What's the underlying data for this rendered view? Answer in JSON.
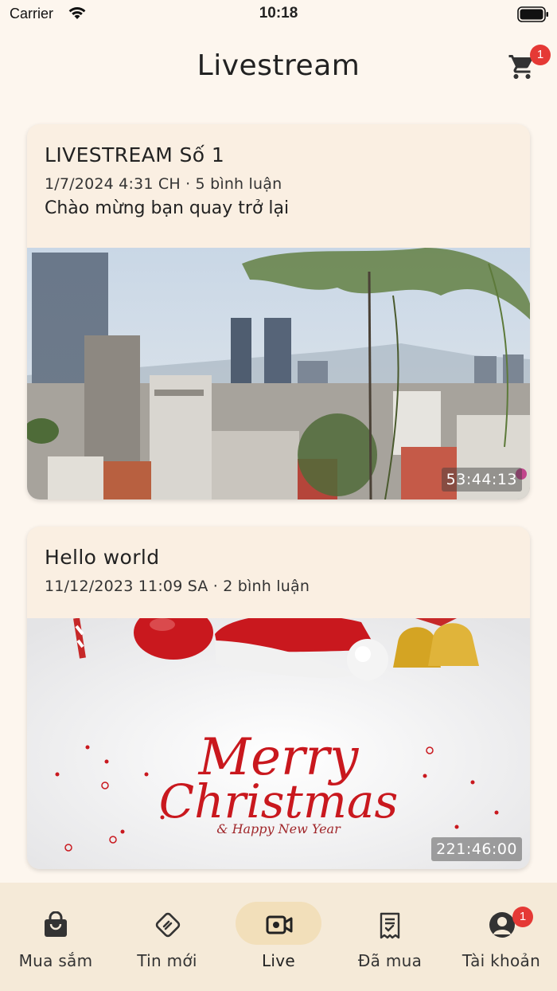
{
  "status_bar": {
    "carrier": "Carrier",
    "time": "10:18"
  },
  "header": {
    "title": "Livestream",
    "cart_badge": "1"
  },
  "streams": [
    {
      "title": "LIVESTREAM Số 1",
      "meta": "1/7/2024 4:31 CH · 5 bình luận",
      "description": "Chào mừng bạn quay trở lại",
      "duration": "53:44:13"
    },
    {
      "title": "Hello world",
      "meta": "11/12/2023 11:09 SA · 2 bình luận",
      "duration": "221:46:00"
    }
  ],
  "tabs": [
    {
      "label": "Mua sắm",
      "icon": "shopping-bag-icon"
    },
    {
      "label": "Tin mới",
      "icon": "news-icon"
    },
    {
      "label": "Live",
      "icon": "video-camera-icon",
      "active": true
    },
    {
      "label": "Đã mua",
      "icon": "receipt-icon"
    },
    {
      "label": "Tài khoản",
      "icon": "user-icon",
      "badge": "1"
    }
  ],
  "colors": {
    "background": "#fdf6ee",
    "card": "#faefe2",
    "active_pill": "#f2dfba",
    "badge": "#e53935"
  }
}
